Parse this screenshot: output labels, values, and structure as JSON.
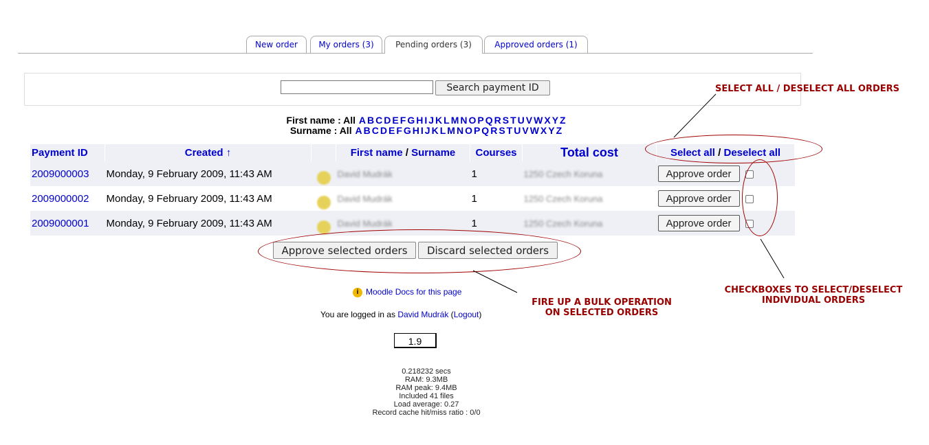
{
  "tabs": [
    {
      "label": "New order"
    },
    {
      "label": "My orders (3)"
    },
    {
      "label": "Pending orders (3)"
    },
    {
      "label": "Approved orders (1)"
    }
  ],
  "search": {
    "value": "",
    "button": "Search payment ID"
  },
  "filters": {
    "firstname_label": "First name :",
    "surname_label": "Surname :",
    "all": "All",
    "letters": [
      "A",
      "B",
      "C",
      "D",
      "E",
      "F",
      "G",
      "H",
      "I",
      "J",
      "K",
      "L",
      "M",
      "N",
      "O",
      "P",
      "Q",
      "R",
      "S",
      "T",
      "U",
      "V",
      "W",
      "X",
      "Y",
      "Z"
    ]
  },
  "table": {
    "headers": {
      "payment_id": "Payment ID",
      "created": "Created",
      "sort_arrow": "↑",
      "first_name": "First name",
      "slash": " / ",
      "surname": "Surname",
      "courses": "Courses",
      "total_cost": "Total cost",
      "select_all": "Select all",
      "deselect_all": "Deselect all"
    },
    "rows": [
      {
        "id": "2009000003",
        "created": "Monday, 9 February 2009, 11:43 AM",
        "name": "David Mudrák",
        "courses": "1",
        "cost": "1250 Czech Koruna",
        "action": "Approve order"
      },
      {
        "id": "2009000002",
        "created": "Monday, 9 February 2009, 11:43 AM",
        "name": "David Mudrák",
        "courses": "1",
        "cost": "1250 Czech Koruna",
        "action": "Approve order"
      },
      {
        "id": "2009000001",
        "created": "Monday, 9 February 2009, 11:43 AM",
        "name": "David Mudrák",
        "courses": "1",
        "cost": "1250 Czech Koruna",
        "action": "Approve order"
      }
    ]
  },
  "bulk": {
    "approve": "Approve selected orders",
    "discard": "Discard selected orders"
  },
  "footer": {
    "docs_link": "Moodle Docs for this page",
    "logged_prefix": "You are logged in as ",
    "user": "David Mudrák",
    "logout": "Logout",
    "version": "1.9",
    "perf": [
      "0.218232 secs",
      "RAM: 9.3MB",
      "RAM peak: 9.4MB",
      "Included 41 files",
      "Load average: 0.27",
      "Record cache hit/miss ratio : 0/0"
    ]
  },
  "annotations": {
    "select_all": "SELECT ALL / DESELECT ALL ORDERS",
    "checkboxes_line1": "CHECKBOXES TO SELECT/DESELECT",
    "checkboxes_line2": "INDIVIDUAL ORDERS",
    "bulk_line1": "FIRE UP A BULK OPERATION",
    "bulk_line2": "ON SELECTED ORDERS"
  },
  "colors": {
    "link": "#0000cc",
    "annotation": "#990000",
    "row_alt": "#eef0f6"
  }
}
